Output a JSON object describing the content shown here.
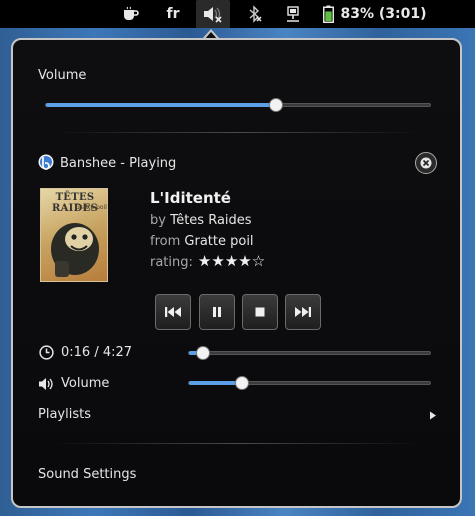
{
  "top_panel": {
    "coffee_icon": "coffee-cup-icon",
    "keyboard_layout": "fr",
    "volume_icon": "speaker-muted-icon",
    "bluetooth_icon": "bluetooth-disabled-icon",
    "network_icon": "network-wired-icon",
    "battery_text": "83% (3:01)",
    "battery_percent": 83
  },
  "menu": {
    "volume_label": "Volume",
    "master_volume_level": 0.6,
    "player": {
      "name": "Banshee - Playing",
      "track_title": "L'Iditenté",
      "artist_prefix": "by",
      "artist": "Têtes Raides",
      "album_prefix": "from",
      "album": "Gratte poil",
      "rating_label": "rating:",
      "rating": 4,
      "rating_max": 5,
      "album_art_title": "TÊTES RAIDES",
      "album_art_subtitle": "Gratte poil",
      "time": "0:16 / 4:27",
      "position_fraction": 0.06,
      "volume_label": "Volume",
      "volume_level": 0.22
    },
    "playlists_label": "Playlists",
    "sound_settings_label": "Sound Settings"
  },
  "colors": {
    "accent": "#5c9ee8",
    "menu_bg": "#0e0e10",
    "border": "#c6c6c6"
  }
}
